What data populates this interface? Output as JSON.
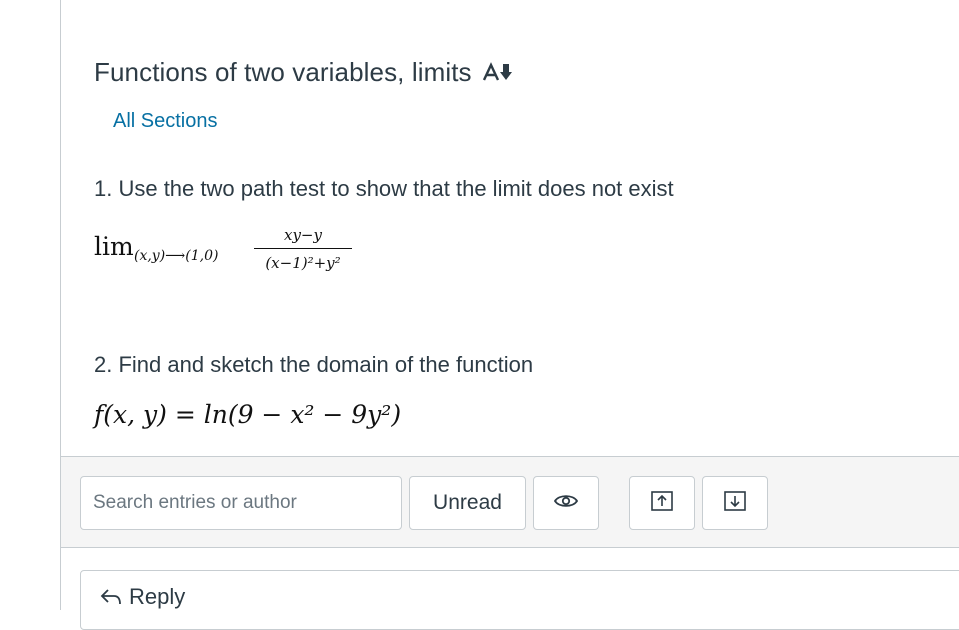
{
  "topic": {
    "title": "Functions of two variables, limits",
    "sections_link": "All Sections"
  },
  "content": {
    "question1": "1. Use the two path test to show that the limit does not exist",
    "limit": {
      "word": "lim",
      "subscript": "(x,y)⟶(1,0)",
      "numerator": "xy−y",
      "denominator": "(x−1)²+y²"
    },
    "question2": "2. Find and sketch the domain of the function",
    "function": "f(x, y) = ln(9 − x² − 9y²)"
  },
  "toolbar": {
    "search_placeholder": "Search entries or author",
    "unread_label": "Unread",
    "icons": [
      "eye-icon",
      "arrow-up-icon",
      "arrow-down-icon"
    ]
  },
  "reply": {
    "label": "Reply"
  },
  "colors": {
    "link": "#0770a3",
    "text": "#2d3b45",
    "border": "#c7cdd1",
    "toolbar_bg": "#f5f5f5"
  }
}
